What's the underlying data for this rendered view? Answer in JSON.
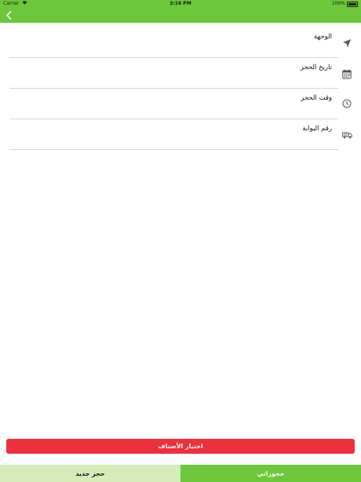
{
  "status_bar": {
    "carrier": "Carrier",
    "time": "3:16 PM",
    "battery": "100%"
  },
  "nav": {
    "back_icon": "chevron-left-icon"
  },
  "form": {
    "rows": [
      {
        "label": "الوجهة",
        "icon": "navigation-arrow-icon"
      },
      {
        "label": "تاريخ الحجز",
        "icon": "calendar-icon"
      },
      {
        "label": "وقت الحجز",
        "icon": "clock-icon"
      },
      {
        "label": "رقم البوابة",
        "icon": "truck-icon"
      }
    ]
  },
  "select_button": {
    "label": "اختيار الأصناف"
  },
  "tabs": {
    "new_booking": "حجز جديد",
    "my_bookings": "حجوزاتي"
  },
  "colors": {
    "brand_green": "#6cc83a",
    "light_green": "#d4edb9",
    "accent_red": "#ee2f3c"
  }
}
